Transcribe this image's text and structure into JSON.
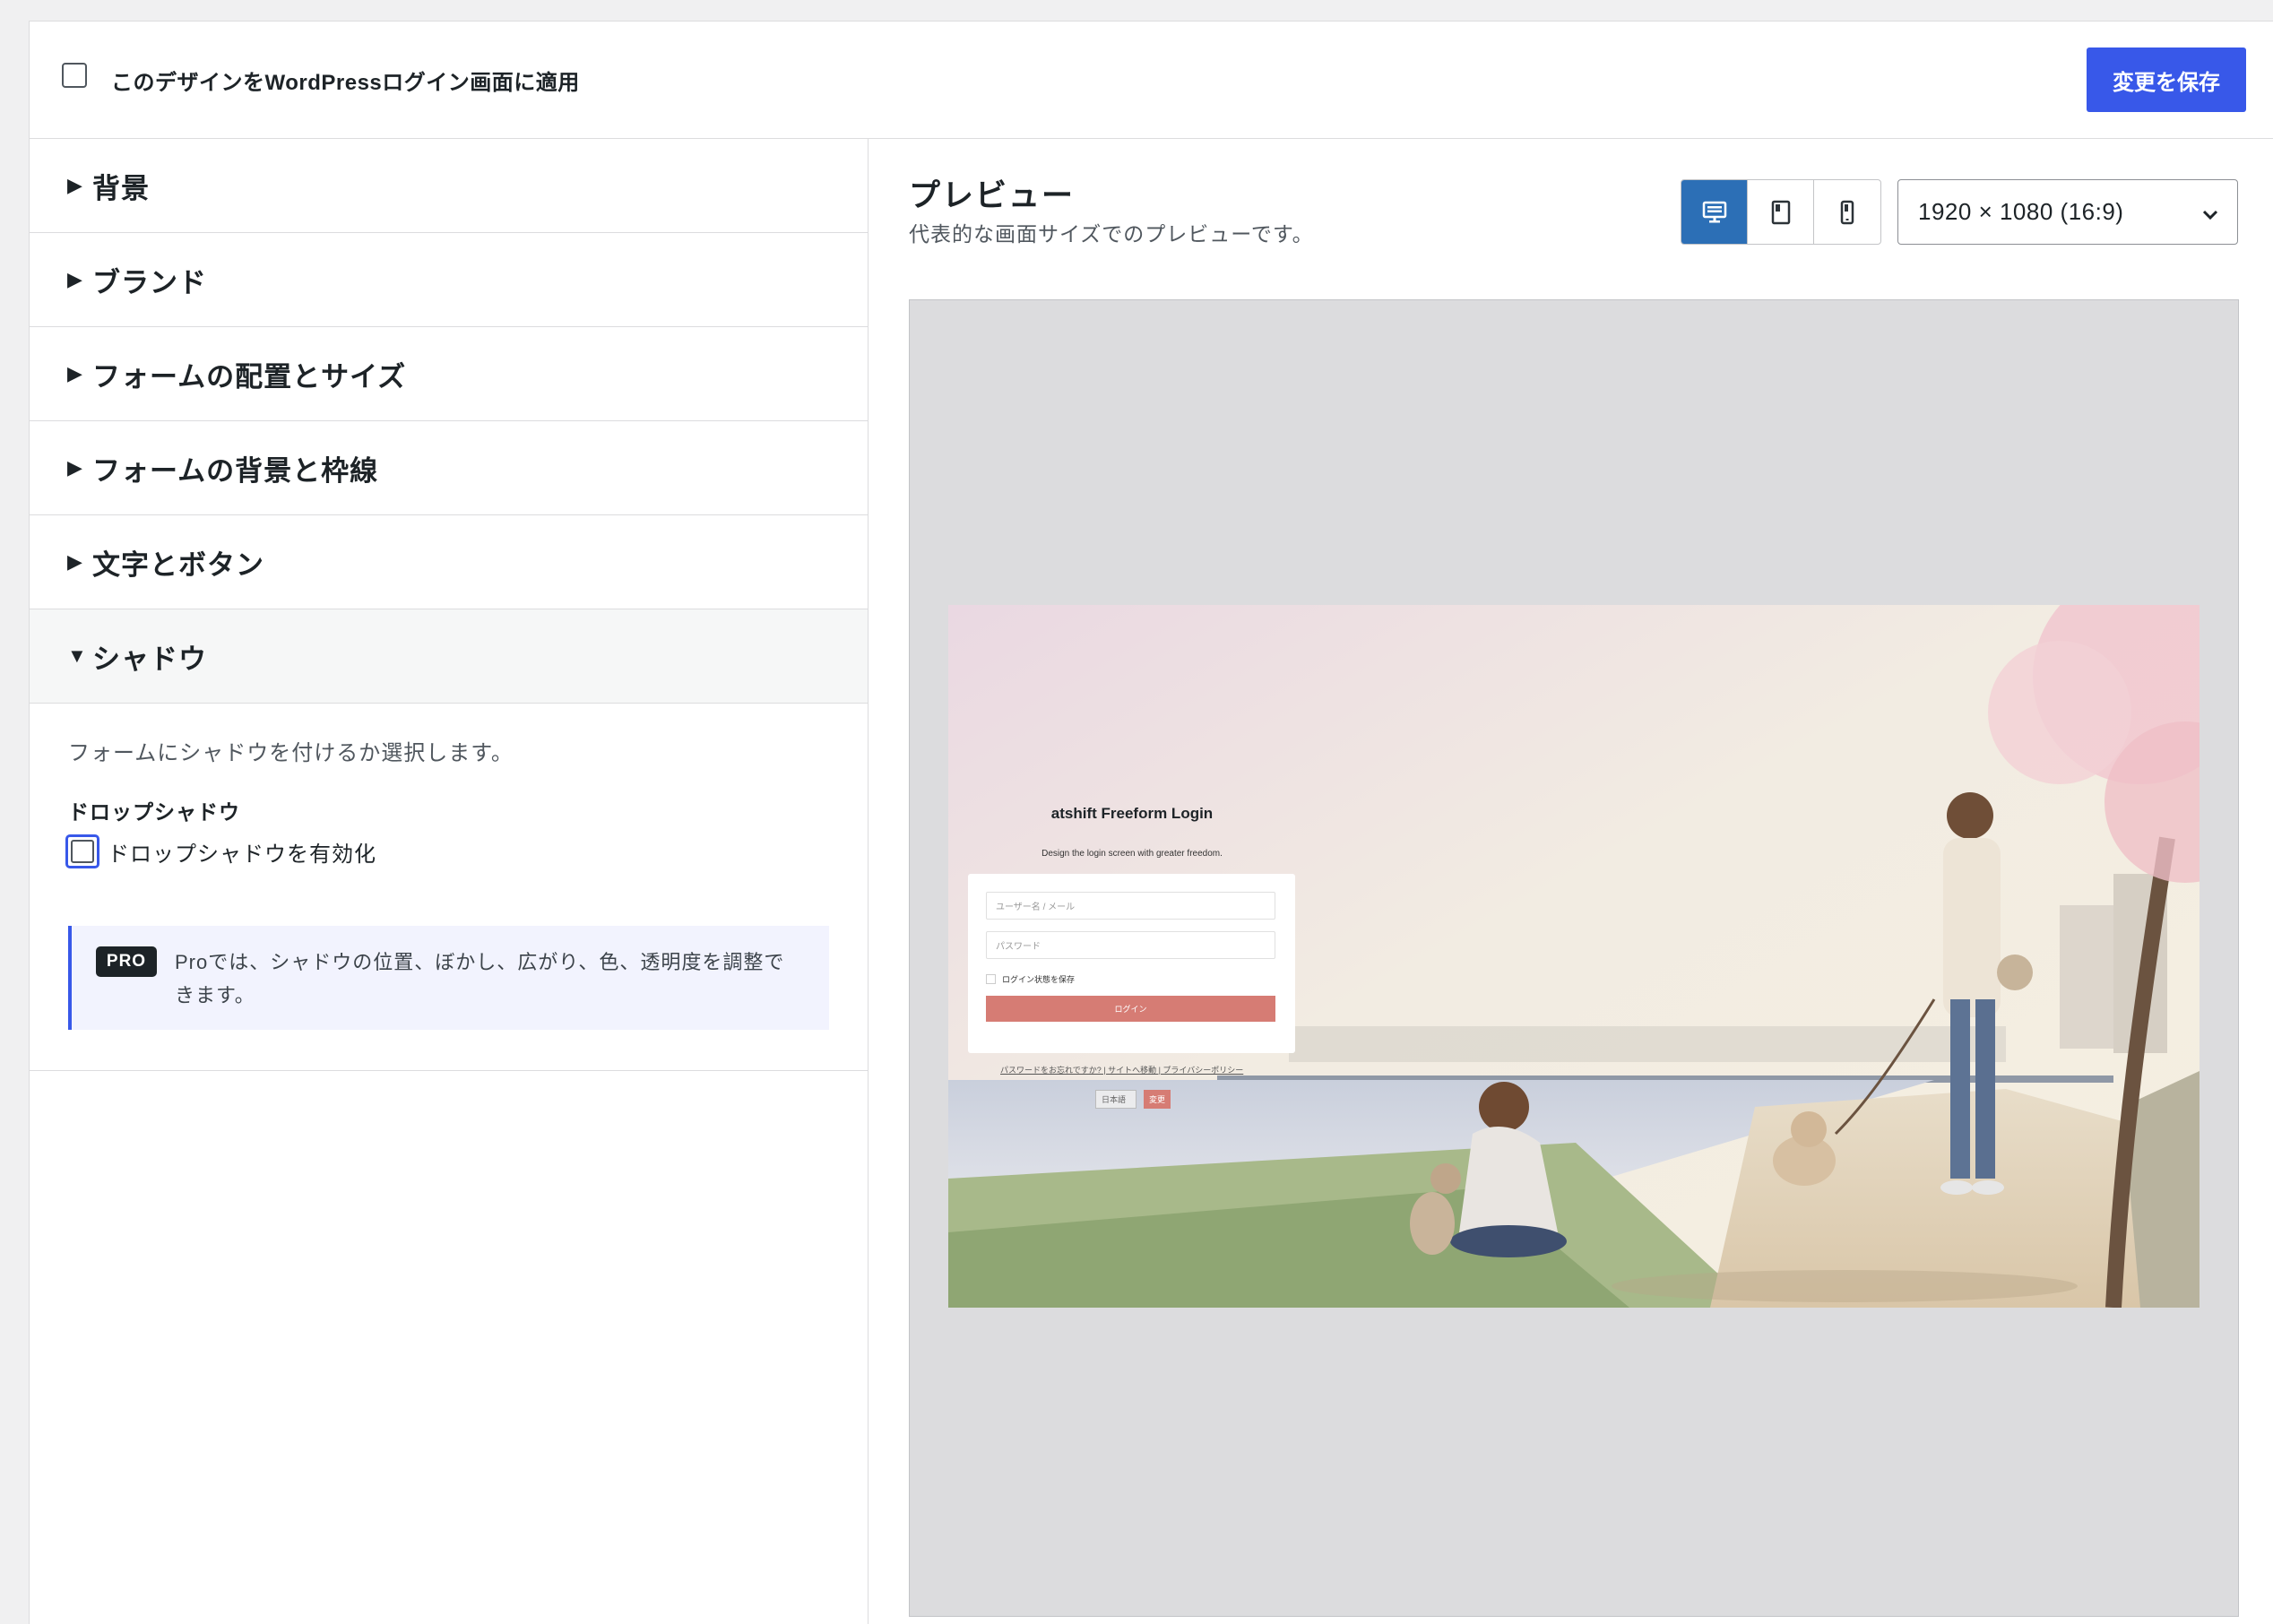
{
  "topbar": {
    "apply_label": "このデザインをWordPressログイン画面に適用",
    "apply_checked": false,
    "save_label": "変更を保存"
  },
  "sections": [
    {
      "label": "背景",
      "open": false
    },
    {
      "label": "ブランド",
      "open": false
    },
    {
      "label": "フォームの配置とサイズ",
      "open": false
    },
    {
      "label": "フォームの背景と枠線",
      "open": false
    },
    {
      "label": "文字とボタン",
      "open": false
    },
    {
      "label": "シャドウ",
      "open": true
    }
  ],
  "arrows": {
    "closed": "▶",
    "open": "▼"
  },
  "shadow": {
    "description": "フォームにシャドウを付けるか選択します。",
    "field_label": "ドロップシャドウ",
    "checkbox_label": "ドロップシャドウを有効化",
    "checkbox_checked": false,
    "pro_badge": "PRO",
    "pro_text": "Proでは、シャドウの位置、ぼかし、広がり、色、透明度を調整できます。"
  },
  "preview": {
    "title": "プレビュー",
    "subtitle": "代表的な画面サイズでのプレビューです。",
    "devices": [
      {
        "icon": "desktop-icon",
        "active": true
      },
      {
        "icon": "tablet-icon",
        "active": false
      },
      {
        "icon": "mobile-icon",
        "active": false
      }
    ],
    "size_select": "1920 × 1080 (16:9)",
    "accent_active": "#2c6fb6"
  },
  "login_mock": {
    "site_title": "atshift Freeform Login",
    "tagline": "Design the login screen with greater freedom.",
    "username_placeholder": "ユーザー名 / メール",
    "password_placeholder": "パスワード",
    "remember_label": "ログイン状態を保存",
    "login_button": "ログイン",
    "links": "パスワードをお忘れですか? | サイトへ移動 | プライバシーポリシー",
    "language": "日本語",
    "change_button": "変更",
    "button_color": "#d67c74"
  },
  "colors": {
    "primary": "#3858e9",
    "text": "#1d2327",
    "border": "#dcdcde"
  }
}
